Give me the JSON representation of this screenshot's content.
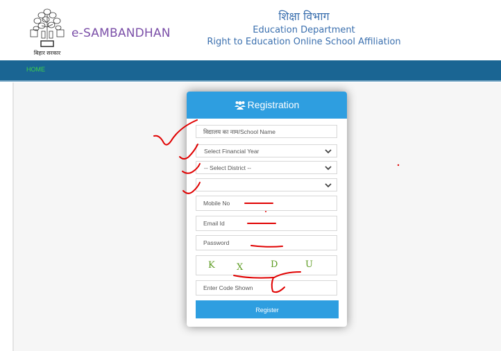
{
  "header": {
    "logo_caption": "बिहार सरकार",
    "brand": "e-SAMBANDHAN",
    "dept_hindi": "शिक्षा विभाग",
    "dept_english": "Education Department",
    "subtitle": "Right to Education Online School Affiliation"
  },
  "nav": {
    "items": [
      {
        "label": "HOME"
      }
    ]
  },
  "form": {
    "title": "Registration",
    "title_icon": "users-icon",
    "school_name": {
      "placeholder": "विद्यालय का नाम/School Name",
      "value": ""
    },
    "financial_year": {
      "selected": "Select Financial Year"
    },
    "district": {
      "selected": "-- Select District --"
    },
    "block": {
      "selected": ""
    },
    "mobile": {
      "placeholder": "Mobile No",
      "value": ""
    },
    "email": {
      "placeholder": "Email Id",
      "value": ""
    },
    "password": {
      "placeholder": "Password",
      "value": ""
    },
    "captcha": {
      "chars": [
        "K",
        "X",
        "D",
        "U"
      ]
    },
    "captcha_input": {
      "placeholder": "Enter Code Shown",
      "value": ""
    },
    "register_label": "Register"
  },
  "colors": {
    "nav_bg": "#1a6593",
    "accent": "#2e9ee0",
    "brand": "#7b4fa8",
    "annotation": "#e00000"
  }
}
